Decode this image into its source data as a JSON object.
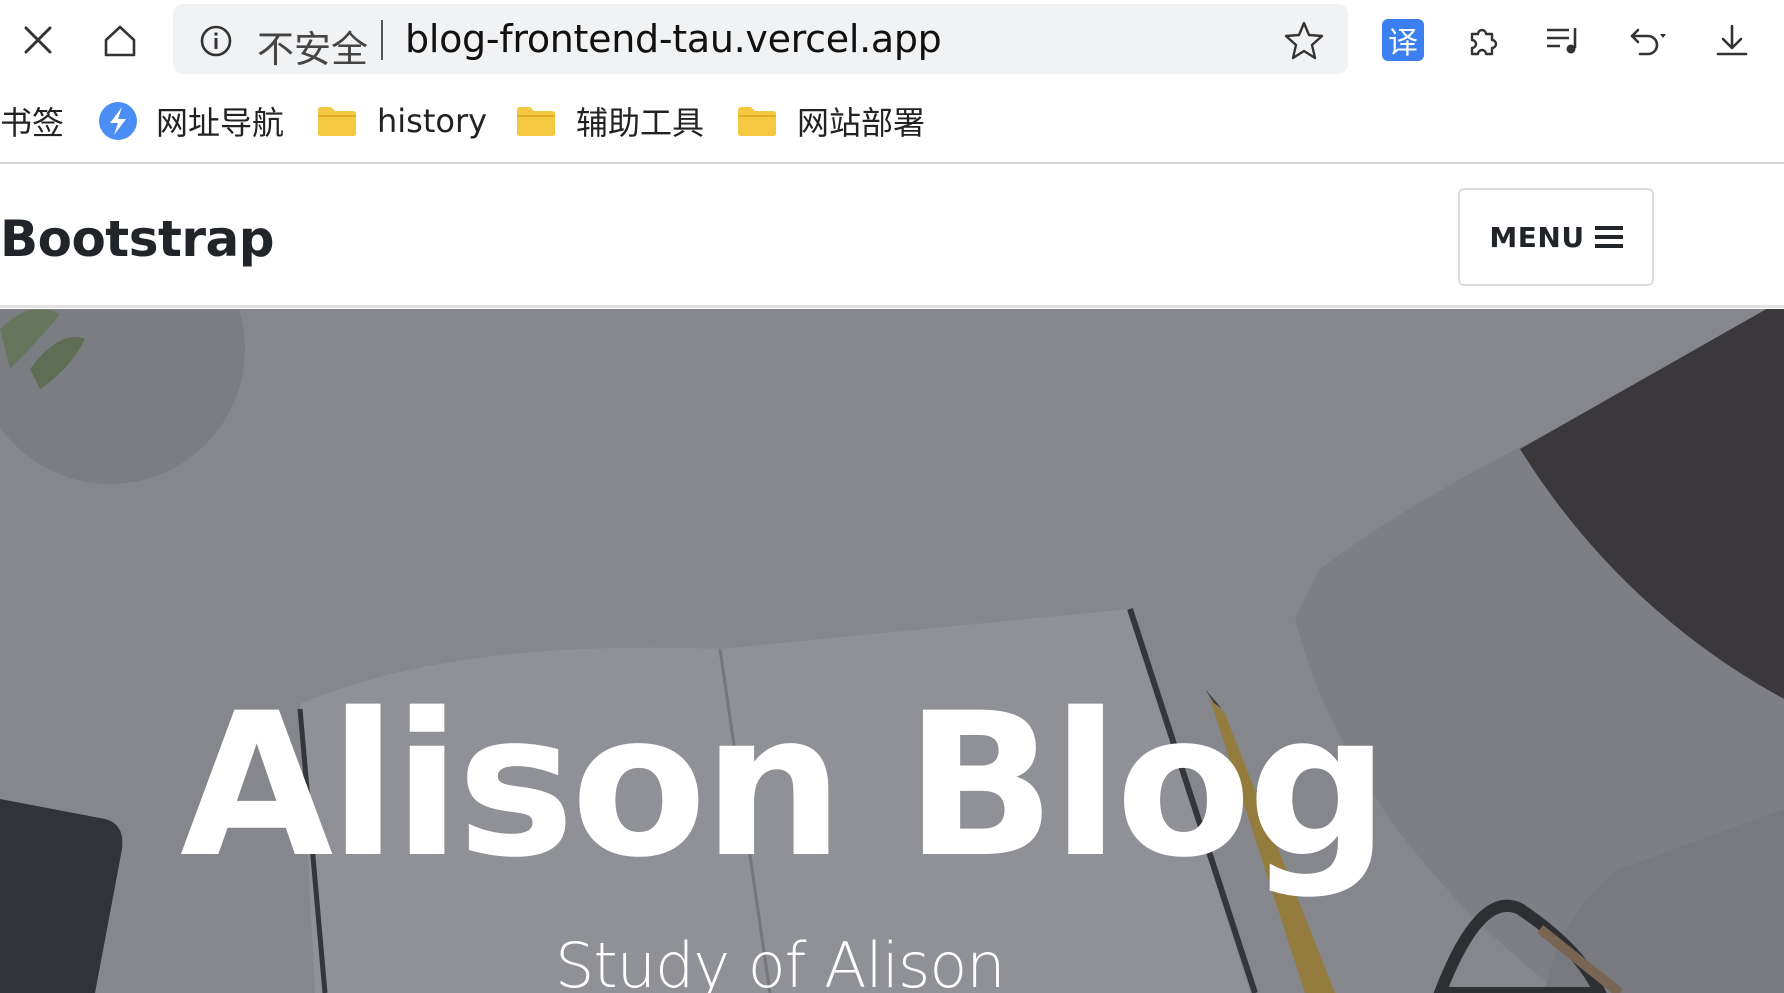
{
  "browser": {
    "omnibox": {
      "security_label": "不安全",
      "url": "blog-frontend-tau.vercel.app"
    },
    "toolbar_icons": [
      "close-icon",
      "home-icon",
      "info-icon",
      "star-icon",
      "translate-icon",
      "extensions-icon",
      "media-control-icon",
      "undo-icon",
      "download-icon"
    ],
    "translate_glyph": "译"
  },
  "bookmarks": {
    "label": "书签",
    "items": [
      {
        "label": "网址导航",
        "icon": "nav-logo-icon"
      },
      {
        "label": "history",
        "icon": "folder-icon"
      },
      {
        "label": "辅助工具",
        "icon": "folder-icon"
      },
      {
        "label": "网站部署",
        "icon": "folder-icon"
      }
    ]
  },
  "site": {
    "brand": "Bootstrap",
    "menu_label": "MENU",
    "hero": {
      "title": "Alison Blog",
      "subtitle": "Study of Alison"
    }
  },
  "colors": {
    "accent_translate": "#3b7ff0",
    "folder": "#f5c842",
    "brand_text": "#212529"
  }
}
